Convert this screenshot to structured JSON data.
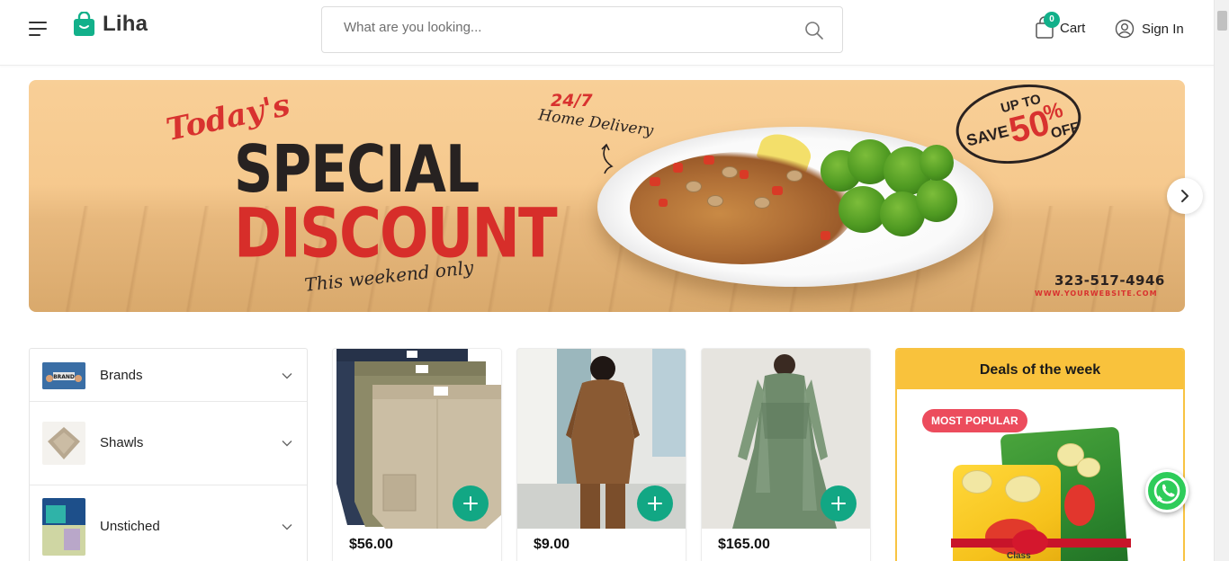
{
  "header": {
    "brand": "Liha",
    "search_placeholder": "What are you looking...",
    "cart_label": "Cart",
    "cart_count": "0",
    "signin_label": "Sign In"
  },
  "banner": {
    "headline_small": "Today's",
    "headline_1": "SPECIAL",
    "headline_2": "DISCOUNT",
    "tagline": "This weekend only",
    "delivery_hours": "24/7",
    "delivery_text": "Home Delivery",
    "offer_upto": "UP TO",
    "offer_save": "SAVE",
    "offer_value": "50",
    "offer_percent": "%",
    "offer_off": "OFF",
    "phone": "323-517-4946",
    "website": "WWW.YOURWEBSITE.COM"
  },
  "sidebar": {
    "categories": [
      {
        "label": "Brands",
        "thumb_text": "BRAND"
      },
      {
        "label": "Shawls"
      },
      {
        "label": "Unstiched"
      }
    ]
  },
  "products": [
    {
      "price": "$56.00"
    },
    {
      "price": "$9.00"
    },
    {
      "price": "$165.00"
    }
  ],
  "deals": {
    "title": "Deals of the week",
    "badge": "MOST POPULAR",
    "pack_label": "Class"
  },
  "colors": {
    "accent": "#12a784",
    "deals_yellow": "#f9c23c",
    "badge_red": "#ec4c5d",
    "banner_bg": "#f6c98e"
  }
}
